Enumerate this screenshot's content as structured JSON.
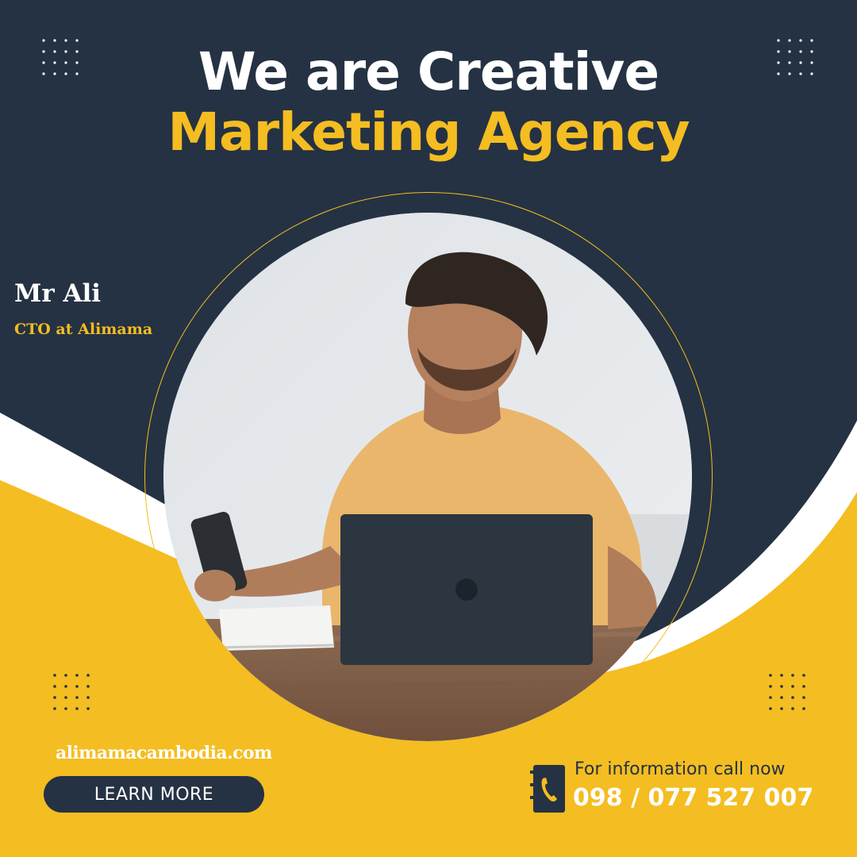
{
  "headline": {
    "line1": "We are Creative",
    "line2": "Marketing Agency"
  },
  "person": {
    "name": "Mr Ali",
    "role": "CTO at Alimama"
  },
  "photo": {
    "subject": "man-with-laptop-and-phone"
  },
  "footer": {
    "website": "alimamacambodia.com",
    "cta_label": "LEARN MORE",
    "contact_caption": "For information call now",
    "phone": "098 / 077 527 007",
    "contact_icon": "phone-book-icon"
  },
  "colors": {
    "navy": "#253243",
    "accent_yellow": "#f4bd21",
    "white": "#ffffff"
  }
}
